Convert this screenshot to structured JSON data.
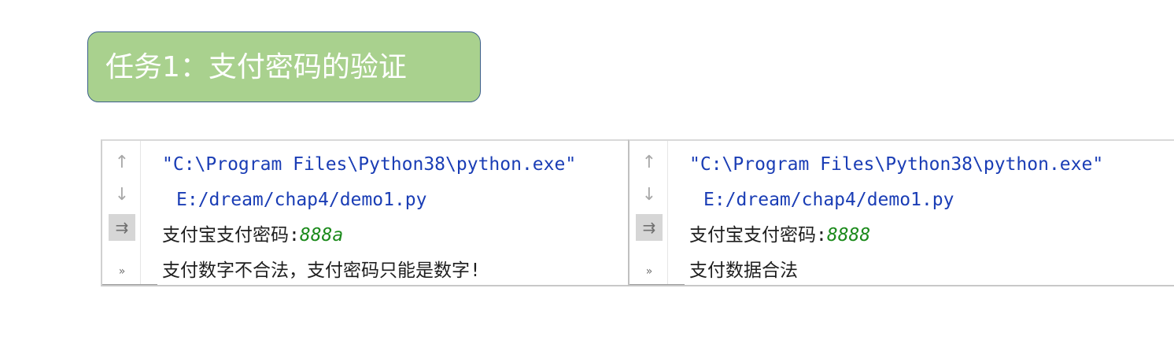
{
  "banner": {
    "title": "任务1：支付密码的验证"
  },
  "icons": {
    "up": "↑",
    "down": "↓",
    "wrap": "⇉",
    "more": "»"
  },
  "consoles": [
    {
      "exe_path": "\"C:\\Program Files\\Python38\\python.exe\"",
      "script_path": "E:/dream/chap4/demo1.py",
      "prompt": "支付宝支付密码:",
      "input": "888a",
      "result": "支付数字不合法，支付密码只能是数字!"
    },
    {
      "exe_path": "\"C:\\Program Files\\Python38\\python.exe\"",
      "script_path": "E:/dream/chap4/demo1.py",
      "prompt": "支付宝支付密码:",
      "input": "8888",
      "result": "支付数据合法"
    }
  ]
}
